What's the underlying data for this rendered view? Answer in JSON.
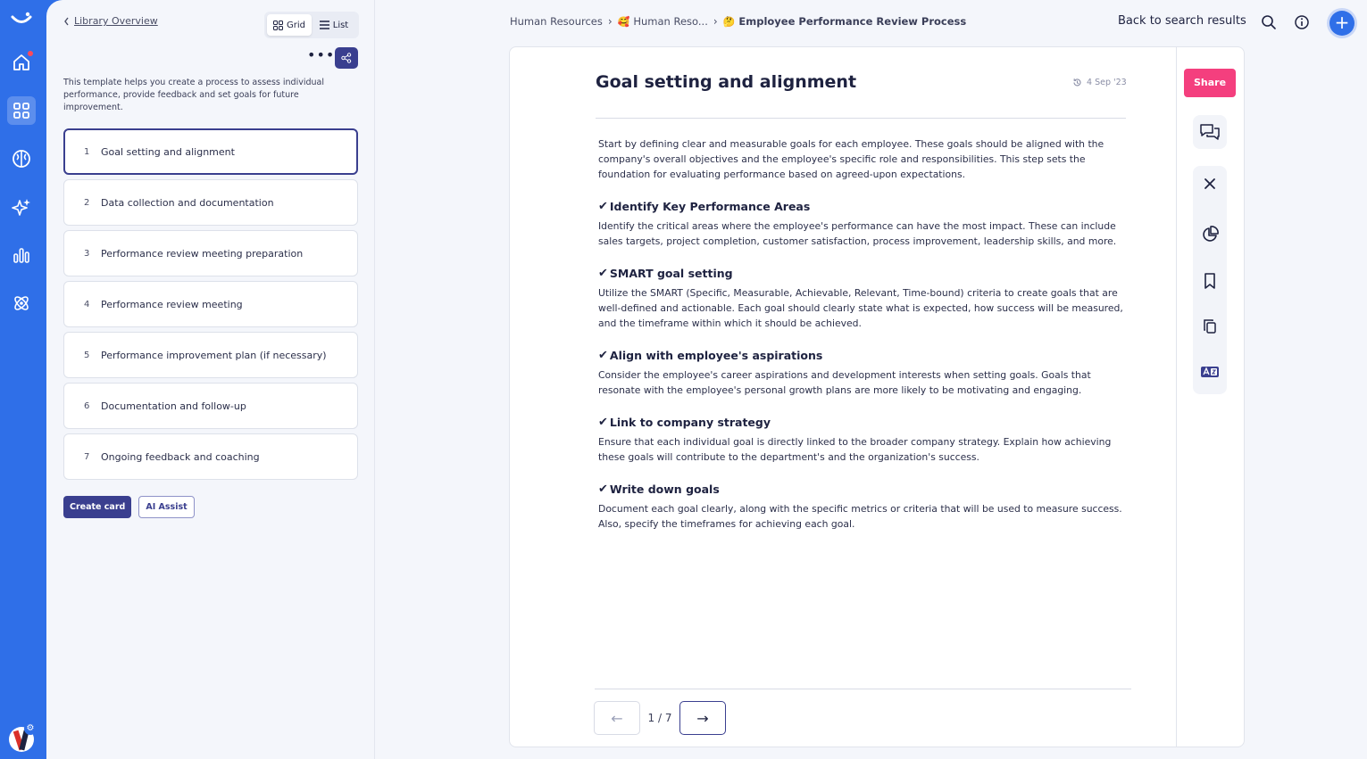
{
  "app": {
    "accent": "#2f6fe8",
    "brand_dark": "#3a3f8f",
    "share_color": "#f43f7e"
  },
  "rail": {
    "items": [
      {
        "icon": "logo-icon"
      },
      {
        "icon": "home-icon",
        "badge": true
      },
      {
        "icon": "grid-icon",
        "active": true
      },
      {
        "icon": "brain-icon"
      },
      {
        "icon": "sparkles-icon"
      },
      {
        "icon": "bar-chart-icon"
      },
      {
        "icon": "atom-icon"
      }
    ]
  },
  "library": {
    "back_label": "Library Overview",
    "view_grid": "Grid",
    "view_list": "List",
    "more_label": "•••",
    "description": "This template helps you create a process to assess individual performance, provide feedback and set goals for future improvement.",
    "steps": [
      {
        "num": "1",
        "label": "Goal setting and alignment"
      },
      {
        "num": "2",
        "label": "Data collection and documentation"
      },
      {
        "num": "3",
        "label": "Performance review meeting preparation"
      },
      {
        "num": "4",
        "label": "Performance review meeting"
      },
      {
        "num": "5",
        "label": "Performance improvement plan (if necessary)"
      },
      {
        "num": "6",
        "label": "Documentation and follow-up"
      },
      {
        "num": "7",
        "label": "Ongoing feedback and coaching"
      }
    ],
    "create_card": "Create card",
    "ai_assist": "AI Assist"
  },
  "header": {
    "crumb1": "Human Resources",
    "crumb2_emoji": "🥰",
    "crumb2": "Human Reso...",
    "crumb3_emoji": "🤔",
    "crumb3": "Employee Performance Review Process",
    "back_results": "Back to search results",
    "plus": "+"
  },
  "doc": {
    "title": "Goal setting and alignment",
    "date": "4 Sep '23",
    "intro": "Start by defining clear and measurable goals for each employee. These goals should be aligned with the company's overall objectives and the employee's specific role and responsibilities. This step sets the foundation for evaluating performance based on agreed-upon expectations.",
    "check": "✔",
    "sections": [
      {
        "heading": "Identify Key Performance Areas",
        "text": "Identify the critical areas where the employee's performance can have the most impact. These can include sales targets, project completion, customer satisfaction, process improvement, leadership skills, and more."
      },
      {
        "heading": "SMART goal setting",
        "text": "Utilize the SMART (Specific, Measurable, Achievable, Relevant, Time-bound) criteria to create goals that are well-defined and actionable. Each goal should clearly state what is expected, how success will be measured, and the timeframe within which it should be achieved."
      },
      {
        "heading": "Align with employee's aspirations",
        "text": "Consider the employee's career aspirations and development interests when setting goals. Goals that resonate with the employee's personal growth plans are more likely to be motivating and engaging."
      },
      {
        "heading": "Link to company strategy",
        "text": "Ensure that each individual goal is directly linked to the broader company strategy. Explain how achieving these goals will contribute to the department's and the organization's success."
      },
      {
        "heading": "Write down goals",
        "text": "Document each goal clearly, along with the specific metrics or criteria that will be used to measure success. Also, specify the timeframes for achieving each goal."
      }
    ],
    "pager": {
      "prev": "←",
      "count": "1 / 7",
      "next": "→"
    }
  },
  "tools": {
    "share_label": "Share"
  }
}
